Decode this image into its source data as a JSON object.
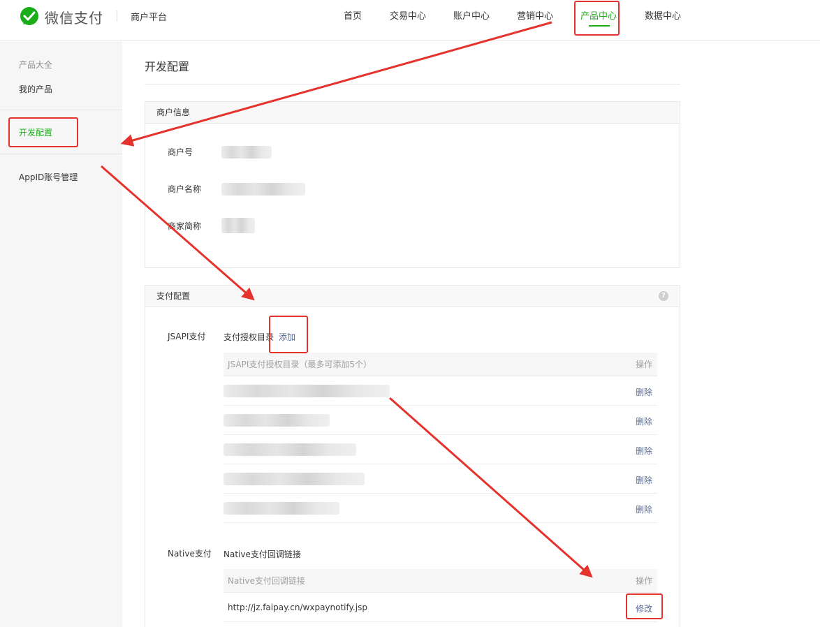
{
  "header": {
    "brand": "微信支付",
    "platform": "商户平台",
    "nav": [
      "首页",
      "交易中心",
      "账户中心",
      "营销中心",
      "产品中心",
      "数据中心"
    ],
    "active_nav": "产品中心"
  },
  "sidebar": {
    "group_title": "产品大全",
    "items": [
      "我的产品",
      "开发配置",
      "AppID账号管理"
    ],
    "active_item": "开发配置"
  },
  "main": {
    "title": "开发配置",
    "merchant_panel": {
      "title": "商户信息",
      "fields": [
        "商户号",
        "商户名称",
        "商家简称"
      ]
    },
    "pay_panel": {
      "title": "支付配置",
      "help": "?",
      "jsapi": {
        "label": "JSAPI支付",
        "dir_label": "支付授权目录",
        "add_link": "添加",
        "table_header": "JSAPI支付授权目录（最多可添加5个）",
        "op_header": "操作",
        "row_action": "删除",
        "rows": 5
      },
      "native": {
        "label": "Native支付",
        "callback_label": "Native支付回调链接",
        "table_header": "Native支付回调链接",
        "op_header": "操作",
        "url": "http://jz.faipay.cn/wxpaynotify.jsp",
        "row_action": "修改"
      }
    }
  },
  "colors": {
    "brand_green": "#1aad19",
    "link_blue": "#576b95",
    "annotation_red": "#e5322d"
  }
}
